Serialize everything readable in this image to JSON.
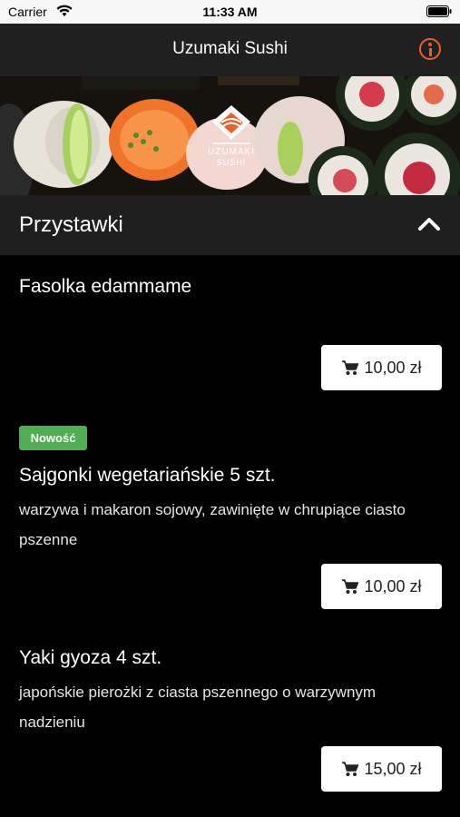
{
  "status_bar": {
    "carrier": "Carrier",
    "time": "11:33 AM"
  },
  "header": {
    "title": "Uzumaki Sushi",
    "info_icon": "info-circle-icon",
    "accent_color": "#e8602c"
  },
  "banner": {
    "logo_text_line1": "UZUMAKI",
    "logo_text_line2": "SUSHI"
  },
  "section": {
    "title": "Przystawki",
    "toggle_icon": "chevron-up-icon"
  },
  "items": [
    {
      "name": "Fasolka edammame",
      "price": "10,00 zł"
    },
    {
      "badge": "Nowość",
      "name": "Sajgonki wegetariańskie 5 szt.",
      "description": "warzywa i makaron sojowy, zawinięte w chrupiące ciasto pszenne",
      "price": "10,00 zł"
    },
    {
      "name": "Yaki gyoza 4 szt.",
      "description": "japońskie pierożki z ciasta pszennego o warzywnym nadzieniu",
      "price": "15,00 zł"
    }
  ],
  "colors": {
    "badge_green": "#4eae50",
    "background": "#000000",
    "header_bg": "#202020"
  }
}
